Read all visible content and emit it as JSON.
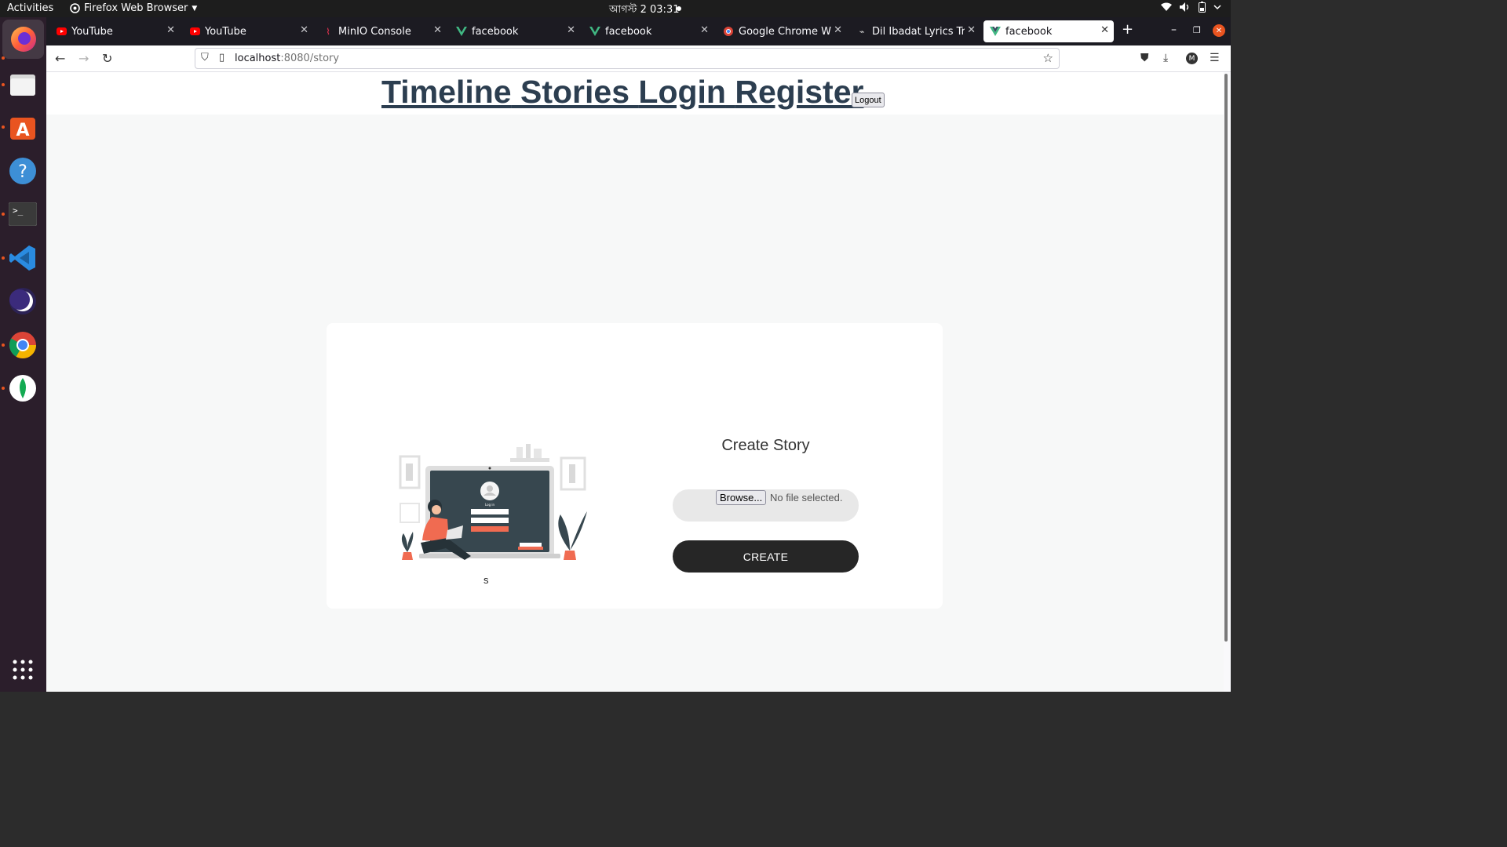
{
  "topbar": {
    "activities": "Activities",
    "app_name": "Firefox Web Browser",
    "clock": "আগস্ট 2  03:31"
  },
  "dock": {
    "items": [
      {
        "name": "firefox",
        "active": true
      },
      {
        "name": "files"
      },
      {
        "name": "ubuntu-software"
      },
      {
        "name": "help"
      },
      {
        "name": "terminal"
      },
      {
        "name": "vscode"
      },
      {
        "name": "eclipse"
      },
      {
        "name": "chrome"
      },
      {
        "name": "mongodb-compass"
      },
      {
        "name": "show-apps"
      }
    ]
  },
  "tabs": [
    {
      "title": "YouTube",
      "icon": "youtube-icon"
    },
    {
      "title": "YouTube",
      "icon": "youtube-icon"
    },
    {
      "title": "MinIO Console",
      "icon": "minio-icon"
    },
    {
      "title": "facebook",
      "icon": "vue-icon"
    },
    {
      "title": "facebook",
      "icon": "vue-icon"
    },
    {
      "title": "Google Chrome Web Browser",
      "icon": "chrome-icon"
    },
    {
      "title": "Dil Ibadat Lyrics Translation",
      "icon": "lyrics-icon"
    },
    {
      "title": "facebook",
      "icon": "vue-icon",
      "active": true
    }
  ],
  "address": {
    "host": "localhost",
    "path": ":8080/story"
  },
  "header": {
    "links": [
      "Timeline",
      "Stories",
      "Login",
      "Register"
    ],
    "logout_label": "Logout"
  },
  "story_form": {
    "title": "Create Story",
    "browse_label": "Browse...",
    "file_status": "No file selected.",
    "create_label": "CREATE",
    "image_caption": "s"
  },
  "colors": {
    "accent_vue": "#41b883",
    "header_link": "#2c3e50",
    "create_button": "#262626",
    "illustration_screen": "#37474f",
    "illustration_accent": "#f06b51"
  }
}
